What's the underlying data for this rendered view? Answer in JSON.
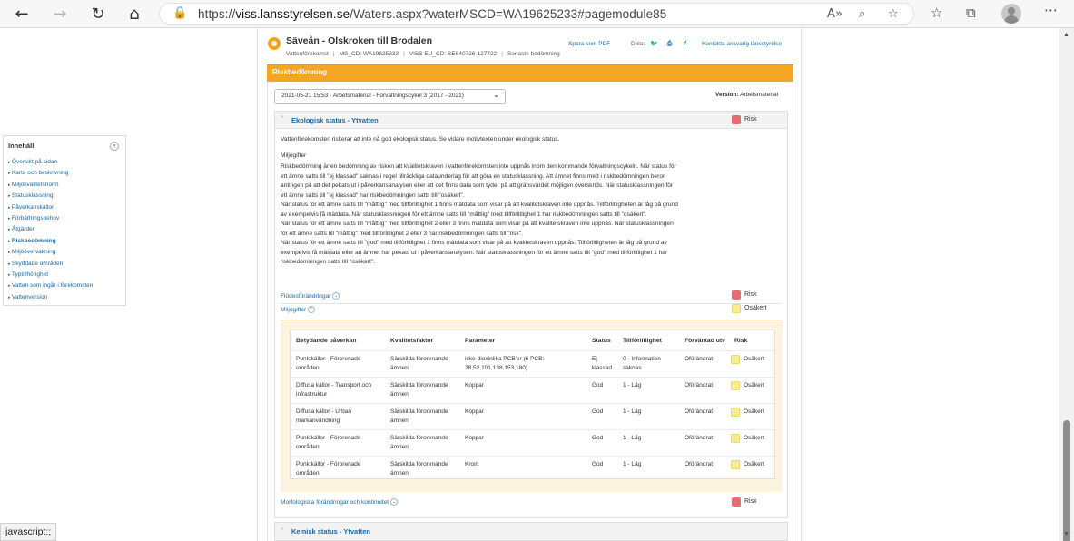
{
  "browser": {
    "url_prefix": "https://",
    "url_host": "viss.lansstyrelsen.se",
    "url_path": "/Waters.aspx?waterMSCD=WA19625233#pagemodule85",
    "icons": [
      "back-arrow",
      "forward-arrow",
      "refresh",
      "home",
      "lock",
      "read-aloud",
      "zoom",
      "add-favorite",
      "favorites",
      "collections",
      "profile",
      "more"
    ],
    "status_bar": "javascript:;"
  },
  "toc": {
    "title": "Innehåll",
    "collapse_symbol": "«",
    "items": [
      {
        "label": "Översikt på sidan",
        "active": false
      },
      {
        "label": "Karta och beskrivning",
        "active": false
      },
      {
        "label": "Miljökvalitetsnorm",
        "active": false
      },
      {
        "label": "Statusklassning",
        "active": false
      },
      {
        "label": "Påverkanskällor",
        "active": false
      },
      {
        "label": "Förbättringsbehov",
        "active": false
      },
      {
        "label": "Åtgärder",
        "active": false
      },
      {
        "label": "Riskbedömning",
        "active": true
      },
      {
        "label": "Miljöövervakning",
        "active": false
      },
      {
        "label": "Skyddade områden",
        "active": false
      },
      {
        "label": "Typtillhörighet",
        "active": false
      },
      {
        "label": "Vatten som ingår i förekomsten",
        "active": false
      },
      {
        "label": "Vattenversion",
        "active": false
      }
    ]
  },
  "header": {
    "name": "Säveån - Olskroken till Brodalen",
    "meta": {
      "type": "Vattenförekomst",
      "ms_cd": "MS_CD: WA19625233",
      "eu_cd": "VISS EU_CD: SE640726-127722",
      "latest": "Senaste bedömning",
      "separator": "|"
    },
    "save_pdf": "Spara som PDF",
    "share_label": "Dela:",
    "share_icons": [
      "twitter-icon",
      "print-icon",
      "facebook-icon"
    ],
    "share_glyphs": {
      "twitter": "🐦",
      "print": "⎙",
      "facebook": "f"
    },
    "contact": "Kontakta ansvarig länsstyrelse"
  },
  "section": {
    "title": "Riskbedömning",
    "dropdown_value": "2021-05-21 15:53 - Arbetsmaterial - Förvaltningscykel 3 (2017 - 2021)",
    "dropdown_chevron": "⌄",
    "version_label": "Version:",
    "version_value": "Arbetsmaterial"
  },
  "eco": {
    "chevron": "˅",
    "title": "Ekologisk status - Ytvatten",
    "status": "Risk",
    "summary": "Vattenförekomsten riskerar att inte nå god ekologisk status. Se vidare motivtexten under ekologisk status.",
    "miljogifter_heading": "Miljögifter",
    "text_lines": [
      "Riskbedömning är en bedömning av risken att kvalitetskraven i vattenförekomsten inte uppnås inom den kommande förvaltningscykeln. När status för",
      "ett ämne satts till \"ej klassad\" saknas i regel tillräckliga dataunderlag för att göra en statusklassning. Att ämnet finns med i riskbedömningen beror",
      "antingen på att det pekats ut i påverkansanalysen eller att det finns data som tyder på att gränsvärdet möjligen överskrids. När statusklassningen för",
      "ett ämne satts till \"ej klassad\" har riskbedömningen satts till \"osäkert\".",
      "När status för ett ämne satts till \"måttlig\" med tillförlitlighet 1 finns mätdata som visar på att kvalitetskraven inte uppnås. Tillförlitligheten är låg på grund",
      "av exempelvis få mätdata. När statusklassningen för ett ämne satts till \"måttlig\" med tillförlitlighet 1 har riskbedömningen satts till \"osäkert\".",
      "När status för ett ämne satts till \"måttlig\" med tillförlitlighet 2 eller 3 finns mätdata som visar på att kvalitetskraven inte uppnås. När statusklassningen",
      "för ett ämne satts till \"måttlig\" med tillförlitlighet 2 eller 3 har riskbedömningen satts till \"risk\".",
      "När status för ett ämne satts till \"god\" med tillförlitlighet 1 finns mätdata som visar på att kvalitetskraven uppnås. Tillförlitligheten är låg på grund av",
      "exempelvis få mätdata eller att ämnet har pekats ut i påverkansanalysen. När statusklassningen för ett ämne satts till \"god\" med tillförlitlighet 1 har",
      "riskbedömningen satts till \"osäkert\"."
    ],
    "flow": {
      "label": "Flödesförändringar",
      "status": "Risk"
    },
    "miljogifter": {
      "label": "Miljögifter",
      "status": "Osäkert"
    },
    "morph": {
      "label": "Morfologiska förändringar och kontinuitet",
      "status": "Risk"
    },
    "expand_glyph": "⌄",
    "collapse_glyph": "⌃"
  },
  "table": {
    "headers": [
      "Betydande påverkan",
      "Kvalitetsfaktor",
      "Parameter",
      "Status",
      "Tillförlitlighet",
      "Förväntad utv",
      "Risk"
    ],
    "rows": [
      {
        "paverkan": [
          "Punktkällor - Förorenade",
          "områden"
        ],
        "faktor": [
          "Särskilda förorenande",
          "ämnen"
        ],
        "parameter": [
          "icke-dioxinlika PCB'er (6 PCB:",
          "28,52,101,138,153,180)"
        ],
        "status": [
          "Ej",
          "klassad"
        ],
        "tillforlitlighet": [
          "0 - Information",
          "saknas"
        ],
        "utv": "Oförändrat",
        "risk": "Osäkert"
      },
      {
        "paverkan": [
          "Diffusa källor - Transport och",
          "infrastruktur"
        ],
        "faktor": [
          "Särskilda förorenande",
          "ämnen"
        ],
        "parameter": [
          "Koppar",
          ""
        ],
        "status": [
          "God",
          ""
        ],
        "tillforlitlighet": [
          "1 - Låg",
          ""
        ],
        "utv": "Oförändrat",
        "risk": "Osäkert"
      },
      {
        "paverkan": [
          "Diffusa källor - Urban",
          "markanvändning"
        ],
        "faktor": [
          "Särskilda förorenande",
          "ämnen"
        ],
        "parameter": [
          "Koppar",
          ""
        ],
        "status": [
          "God",
          ""
        ],
        "tillforlitlighet": [
          "1 - Låg",
          ""
        ],
        "utv": "Oförändrat",
        "risk": "Osäkert"
      },
      {
        "paverkan": [
          "Punktkällor - Förorenade",
          "områden"
        ],
        "faktor": [
          "Särskilda förorenande",
          "ämnen"
        ],
        "parameter": [
          "Koppar",
          ""
        ],
        "status": [
          "God",
          ""
        ],
        "tillforlitlighet": [
          "1 - Låg",
          ""
        ],
        "utv": "Oförändrat",
        "risk": "Osäkert"
      },
      {
        "paverkan": [
          "Punktkällor - Förorenade",
          "områden"
        ],
        "faktor": [
          "Särskilda förorenande",
          "ämnen"
        ],
        "parameter": [
          "Krom",
          ""
        ],
        "status": [
          "God",
          ""
        ],
        "tillforlitlighet": [
          "1 - Låg",
          ""
        ],
        "utv": "Oförändrat",
        "risk": "Osäkert"
      }
    ]
  },
  "chem": {
    "title": "Kemisk status - Ytvatten",
    "chevron": "˅"
  },
  "colors": {
    "accent_orange": "#f4a623",
    "link_blue": "#1a6aa8",
    "risk_red": "#e36d72",
    "uncertain_yellow": "#f8ee91"
  }
}
